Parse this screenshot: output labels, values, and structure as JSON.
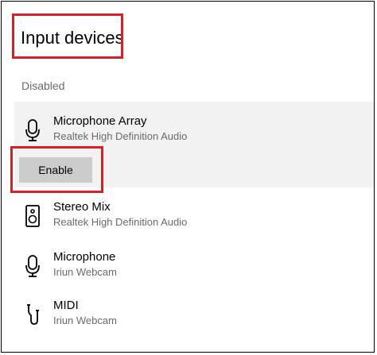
{
  "header": {
    "title": "Input devices"
  },
  "section": {
    "label": "Disabled"
  },
  "devices": [
    {
      "name": "Microphone Array",
      "subtitle": "Realtek High Definition Audio",
      "icon": "microphone-icon",
      "selected": true
    },
    {
      "name": "Stereo Mix",
      "subtitle": "Realtek High Definition Audio",
      "icon": "speaker-icon"
    },
    {
      "name": "Microphone",
      "subtitle": "Iriun Webcam",
      "icon": "microphone-icon"
    },
    {
      "name": "MIDI",
      "subtitle": "Iriun Webcam",
      "icon": "midi-cable-icon"
    }
  ],
  "actions": {
    "enable_label": "Enable"
  },
  "colors": {
    "highlight": "#d61f26",
    "selected_bg": "#f2f2f2",
    "button_bg": "#cccccc",
    "secondary_text": "#6b6b6b"
  }
}
